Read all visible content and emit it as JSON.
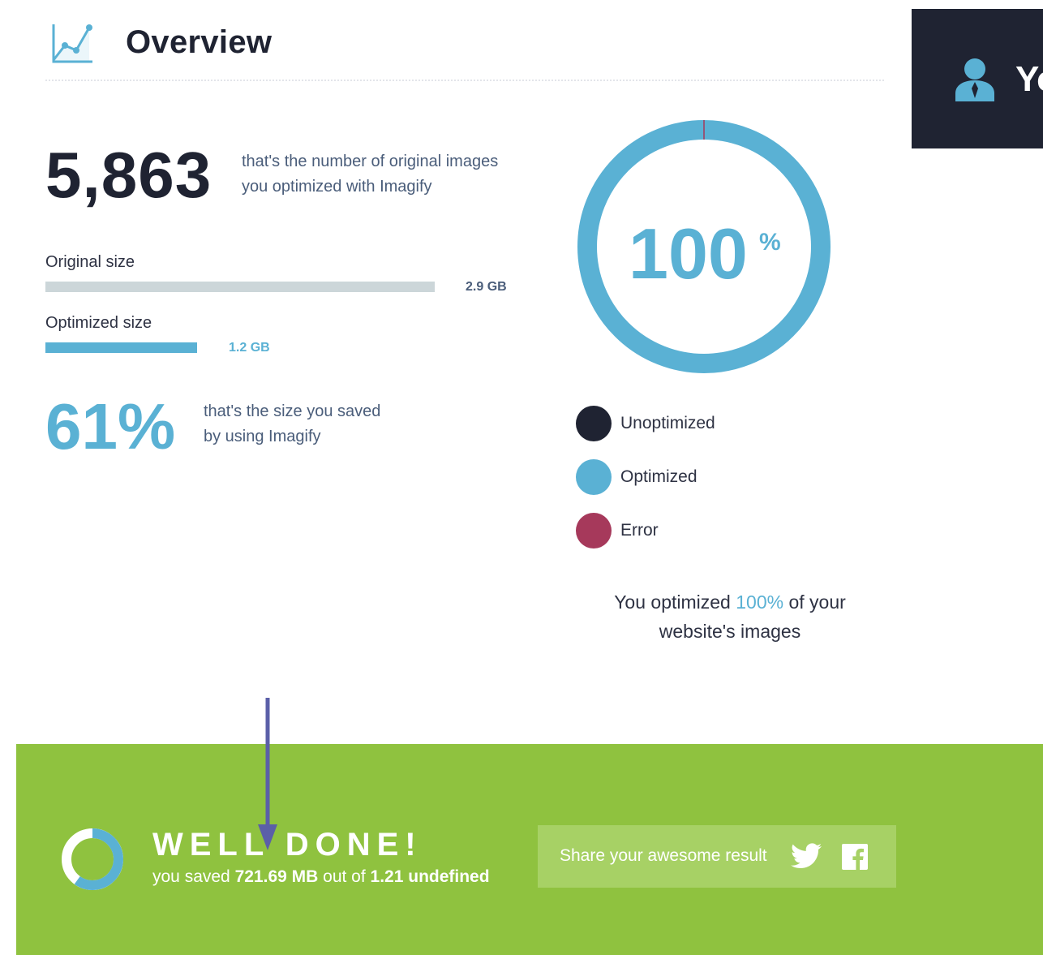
{
  "header": {
    "title": "Overview",
    "icon": "chart-line-icon"
  },
  "account_panel": {
    "label": "Yo",
    "icon": "user-icon"
  },
  "stats": {
    "images_count": "5,863",
    "images_caption_line1": "that's the number of original images",
    "images_caption_line2": "you optimized with Imagify",
    "original_size_label": "Original size",
    "original_size_value": "2.9 GB",
    "original_size_fraction": 1.0,
    "optimized_size_label": "Optimized size",
    "optimized_size_value": "1.2 GB",
    "optimized_size_fraction": 0.39,
    "saved_percent": "61%",
    "saved_caption_line1": "that's the size you saved",
    "saved_caption_line2": "by using Imagify"
  },
  "chart_data": {
    "type": "pie",
    "categories": [
      "Unoptimized",
      "Optimized",
      "Error"
    ],
    "values": [
      0,
      100,
      0
    ],
    "center_value": "100",
    "center_unit": "%"
  },
  "legend": {
    "items": [
      {
        "label": "Unoptimized",
        "color": "#1f2332"
      },
      {
        "label": "Optimized",
        "color": "#5ab1d4"
      },
      {
        "label": "Error",
        "color": "#a6395b"
      }
    ]
  },
  "summary": {
    "prefix": "You optimized ",
    "highlight": "100%",
    "suffix": " of your",
    "line2": "website's images"
  },
  "banner": {
    "title": "WELL DONE!",
    "sub_prefix": "you saved ",
    "saved_amount": "721.69 MB",
    "sub_middle": " out of ",
    "total_amount": "1.21 undefined",
    "ring_fraction": 0.6,
    "share_label": "Share your awesome result",
    "twitter_icon": "twitter-icon",
    "facebook_icon": "facebook-icon"
  },
  "colors": {
    "accent": "#5ab1d4",
    "dark": "#1f2332",
    "green": "#8fc23f",
    "error": "#a6395b",
    "annotation_arrow": "#5b5fa8"
  }
}
